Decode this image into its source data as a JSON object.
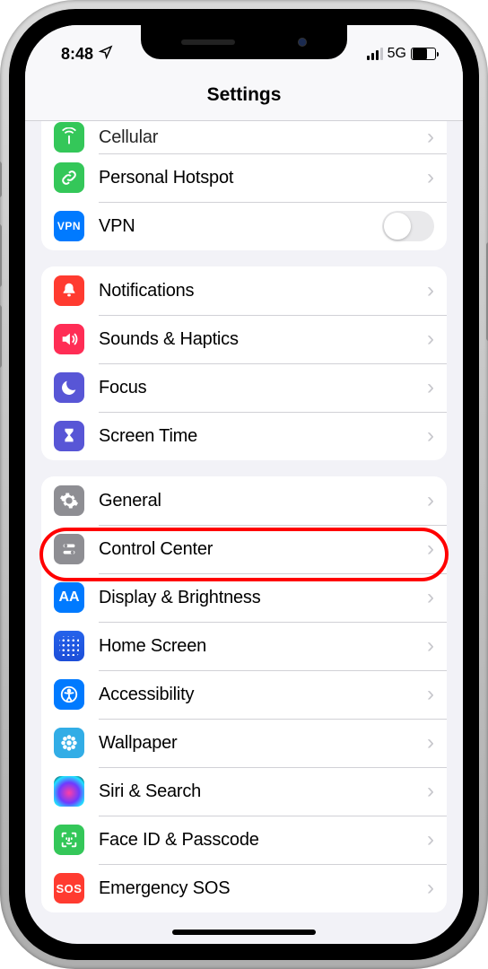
{
  "status": {
    "time": "8:48",
    "network": "5G"
  },
  "nav": {
    "title": "Settings"
  },
  "groups": [
    {
      "id": "connectivity",
      "partial_top": true,
      "rows": [
        {
          "id": "cellular",
          "label": "Cellular",
          "icon": "antenna-icon",
          "color": "bg-green",
          "acc": "chevron"
        },
        {
          "id": "hotspot",
          "label": "Personal Hotspot",
          "icon": "link-icon",
          "color": "bg-green",
          "acc": "chevron"
        },
        {
          "id": "vpn",
          "label": "VPN",
          "icon": "vpn-icon",
          "color": "bg-blue",
          "acc": "toggle",
          "toggle_on": false
        }
      ]
    },
    {
      "id": "alerts",
      "rows": [
        {
          "id": "notifications",
          "label": "Notifications",
          "icon": "bell-icon",
          "color": "bg-red",
          "acc": "chevron"
        },
        {
          "id": "sounds",
          "label": "Sounds & Haptics",
          "icon": "speaker-icon",
          "color": "bg-pink",
          "acc": "chevron"
        },
        {
          "id": "focus",
          "label": "Focus",
          "icon": "moon-icon",
          "color": "bg-indigo",
          "acc": "chevron"
        },
        {
          "id": "screentime",
          "label": "Screen Time",
          "icon": "hourglass-icon",
          "color": "bg-indigo",
          "acc": "chevron"
        }
      ]
    },
    {
      "id": "system",
      "rows": [
        {
          "id": "general",
          "label": "General",
          "icon": "gear-icon",
          "color": "bg-gray",
          "acc": "chevron",
          "highlighted": true
        },
        {
          "id": "controlcenter",
          "label": "Control Center",
          "icon": "switches-icon",
          "color": "bg-gray",
          "acc": "chevron"
        },
        {
          "id": "display",
          "label": "Display & Brightness",
          "icon": "aa-icon",
          "color": "bg-blue",
          "acc": "chevron"
        },
        {
          "id": "homescreen",
          "label": "Home Screen",
          "icon": "grid-icon",
          "color": "bg-darkgrid",
          "acc": "chevron"
        },
        {
          "id": "accessibility",
          "label": "Accessibility",
          "icon": "accessibility-icon",
          "color": "bg-blue",
          "acc": "chevron"
        },
        {
          "id": "wallpaper",
          "label": "Wallpaper",
          "icon": "flower-icon",
          "color": "bg-cyan",
          "acc": "chevron"
        },
        {
          "id": "siri",
          "label": "Siri & Search",
          "icon": "siri-icon",
          "color": "siri-bg",
          "acc": "chevron"
        },
        {
          "id": "faceid",
          "label": "Face ID & Passcode",
          "icon": "faceid-icon",
          "color": "bg-faceid",
          "acc": "chevron"
        },
        {
          "id": "sos",
          "label": "Emergency SOS",
          "icon": "sos-icon",
          "color": "bg-red",
          "acc": "chevron"
        }
      ]
    }
  ],
  "highlight_row": "general"
}
